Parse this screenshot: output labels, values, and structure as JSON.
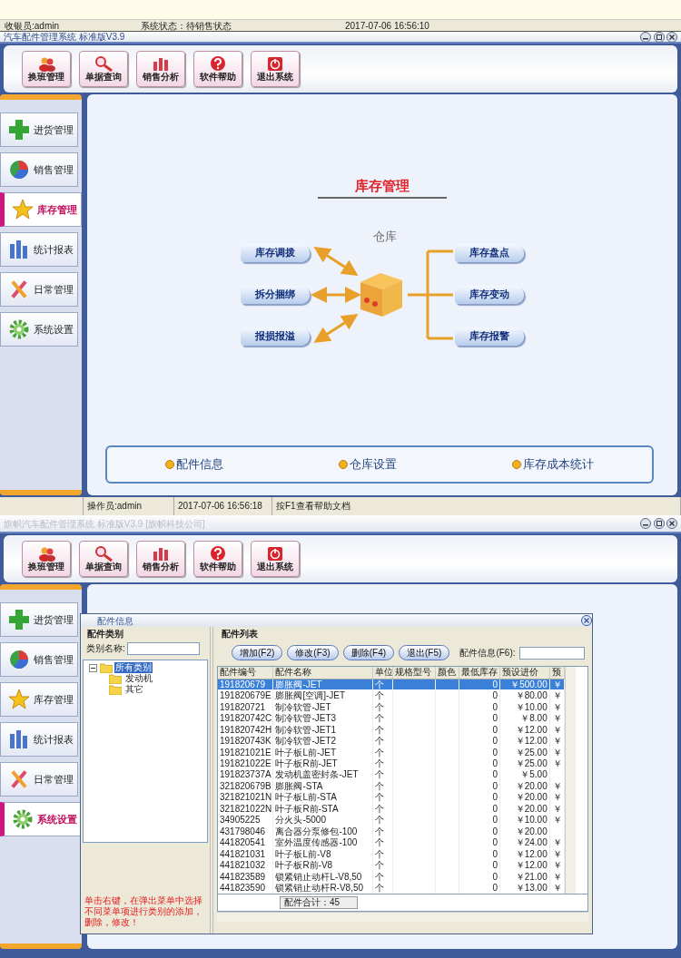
{
  "top_status": {
    "cashier": "收银员:admin",
    "system_state": "系统状态：待销售状态",
    "time": "2017-07-06 16:56:10"
  },
  "windows": [
    {
      "title": "汽车配件管理系统 标准版V3.9",
      "title_dimmed": false,
      "toolbar": [
        {
          "label": "换班管理",
          "kind": "people"
        },
        {
          "label": "单据查询",
          "kind": "search"
        },
        {
          "label": "销售分析",
          "kind": "chart"
        },
        {
          "label": "软件帮助",
          "kind": "help"
        },
        {
          "label": "退出系统",
          "kind": "power"
        }
      ],
      "sidebar": [
        {
          "label": "进货管理",
          "kind": "plus",
          "selected": false
        },
        {
          "label": "销售管理",
          "kind": "pie",
          "selected": false
        },
        {
          "label": "库存管理",
          "kind": "star",
          "selected": true
        },
        {
          "label": "统计报表",
          "kind": "bars",
          "selected": false
        },
        {
          "label": "日常管理",
          "kind": "tools",
          "selected": false
        },
        {
          "label": "系统设置",
          "kind": "gear",
          "selected": false
        }
      ],
      "content": {
        "heading": "库存管理",
        "center_label": "仓库",
        "left_actions": [
          "库存调拨",
          "拆分捆绑",
          "报损报溢"
        ],
        "right_actions": [
          "库存盘点",
          "库存变动",
          "库存报警"
        ],
        "links": [
          "配件信息",
          "仓库设置",
          "库存成本统计"
        ]
      },
      "status_bar": [
        "操作员:admin",
        "2017-07-06 16:56:18",
        "按F1查看帮助文档"
      ]
    },
    {
      "title": "旗帜汽车配件管理系统 标准版V3.9 [旗帜科技公司]",
      "title_dimmed": true,
      "toolbar": [
        {
          "label": "换班管理",
          "kind": "people"
        },
        {
          "label": "单据查询",
          "kind": "search"
        },
        {
          "label": "销售分析",
          "kind": "chart"
        },
        {
          "label": "软件帮助",
          "kind": "help"
        },
        {
          "label": "退出系统",
          "kind": "power"
        }
      ],
      "sidebar": [
        {
          "label": "进货管理",
          "kind": "plus",
          "selected": false
        },
        {
          "label": "销售管理",
          "kind": "pie",
          "selected": false
        },
        {
          "label": "库存管理",
          "kind": "star",
          "selected": false
        },
        {
          "label": "统计报表",
          "kind": "bars",
          "selected": false
        },
        {
          "label": "日常管理",
          "kind": "tools",
          "selected": false
        },
        {
          "label": "系统设置",
          "kind": "gear",
          "selected": true
        }
      ],
      "dialog": {
        "title": "配件信息",
        "category_panel": {
          "legend": "配件类别",
          "name_label": "类别名称:",
          "tree": [
            {
              "label": "所有类别",
              "selected": true,
              "expanded": true,
              "children": [
                {
                  "label": "发动机",
                  "selected": false
                },
                {
                  "label": "其它",
                  "selected": false
                }
              ]
            }
          ],
          "hint": "单击右键，在弹出菜单中选择不同菜单项进行类别的添加，删除，修改！"
        },
        "list_panel": {
          "legend": "配件列表",
          "buttons": [
            "增加(F2)",
            "修改(F3)",
            "删除(F4)",
            "退出(F5)"
          ],
          "search_label": "配件信息(F6):",
          "table": {
            "columns": [
              "配件编号",
              "配件名称",
              "单位",
              "规格型号",
              "颜色",
              "最低库存",
              "预设进价",
              "预"
            ],
            "rows": [
              {
                "code": "191820679",
                "name": "膨胀阀-JET",
                "unit": "个",
                "min_stock": "0",
                "price": "￥500.00",
                "column_8": "￥",
                "selected": true
              },
              {
                "code": "191820679E",
                "name": "膨胀阀[空调]-JET",
                "unit": "个",
                "min_stock": "0",
                "price": "￥80.00",
                "column_8": "￥",
                "selected": false
              },
              {
                "code": "191820721",
                "name": "制冷软管-JET",
                "unit": "个",
                "min_stock": "0",
                "price": "￥10.00",
                "column_8": "￥",
                "selected": false
              },
              {
                "code": "191820742C",
                "name": "制冷软管-JET3",
                "unit": "个",
                "min_stock": "0",
                "price": "￥8.00",
                "column_8": "￥",
                "selected": false
              },
              {
                "code": "191820742H",
                "name": "制冷软管-JET1",
                "unit": "个",
                "min_stock": "0",
                "price": "￥12.00",
                "column_8": "￥",
                "selected": false
              },
              {
                "code": "191820743K",
                "name": "制冷软管-JET2",
                "unit": "个",
                "min_stock": "0",
                "price": "￥12.00",
                "column_8": "￥",
                "selected": false
              },
              {
                "code": "191821021E",
                "name": "叶子板L前-JET",
                "unit": "个",
                "min_stock": "0",
                "price": "￥25.00",
                "column_8": "￥",
                "selected": false
              },
              {
                "code": "191821022E",
                "name": "叶子板R前-JET",
                "unit": "个",
                "min_stock": "0",
                "price": "￥25.00",
                "column_8": "￥",
                "selected": false
              },
              {
                "code": "191823737A",
                "name": "发动机盖密封条-JET",
                "unit": "个",
                "min_stock": "0",
                "price": "￥5.00",
                "selected": false
              },
              {
                "code": "321820679B",
                "name": "膨胀阀-STA",
                "unit": "个",
                "min_stock": "0",
                "price": "￥20.00",
                "column_8": "￥",
                "selected": false
              },
              {
                "code": "321821021N",
                "name": "叶子板L前-STA",
                "unit": "个",
                "min_stock": "0",
                "price": "￥20.00",
                "column_8": "￥",
                "selected": false
              },
              {
                "code": "321821022N",
                "name": "叶子板R前-STA",
                "unit": "个",
                "min_stock": "0",
                "price": "￥20.00",
                "column_8": "￥",
                "selected": false
              },
              {
                "code": "34905225",
                "name": "分火头-5000",
                "unit": "个",
                "min_stock": "0",
                "price": "￥10.00",
                "column_8": "￥",
                "selected": false
              },
              {
                "code": "431798046",
                "name": "离合器分泵修包-100",
                "unit": "个",
                "min_stock": "0",
                "price": "￥20.00",
                "selected": false
              },
              {
                "code": "441820541",
                "name": "室外温度传感器-100",
                "unit": "个",
                "min_stock": "0",
                "price": "￥24.00",
                "column_8": "￥",
                "selected": false
              },
              {
                "code": "441821031",
                "name": "叶子板L前-V8",
                "unit": "个",
                "min_stock": "0",
                "price": "￥12.00",
                "column_8": "￥",
                "selected": false
              },
              {
                "code": "441821032",
                "name": "叶子板R前-V8",
                "unit": "个",
                "min_stock": "0",
                "price": "￥12.00",
                "column_8": "￥",
                "selected": false
              },
              {
                "code": "441823589",
                "name": "锁紧销止动杆L-V8,50",
                "unit": "个",
                "min_stock": "0",
                "price": "￥21.00",
                "column_8": "￥",
                "selected": false
              },
              {
                "code": "441823590",
                "name": "锁紧销止动杆R-V8,50",
                "unit": "个",
                "min_stock": "0",
                "price": "￥13.00",
                "column_8": "￥",
                "selected": false
              }
            ]
          },
          "total": "配件合计：45"
        }
      }
    }
  ]
}
